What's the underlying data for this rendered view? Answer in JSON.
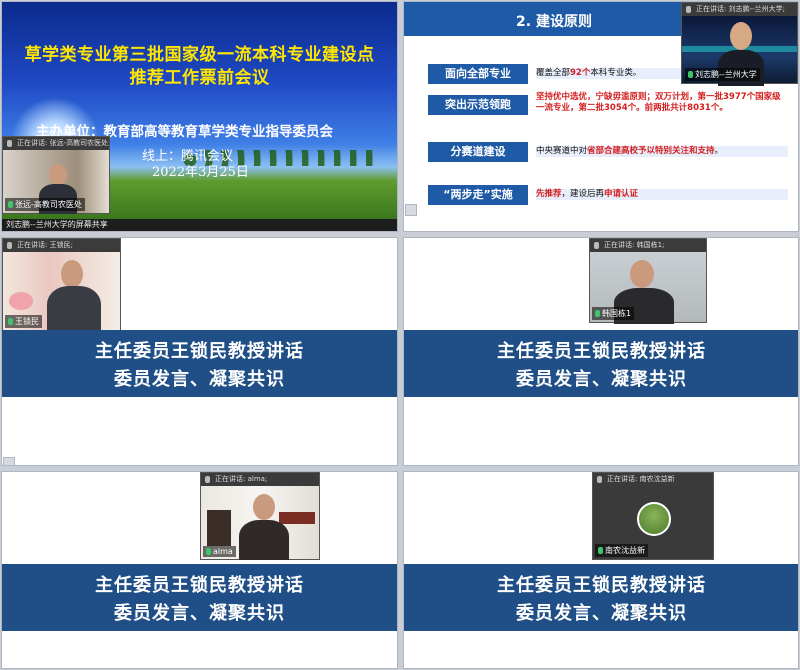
{
  "title_slide": {
    "title_line1": "草学类专业第三批国家级一流本科专业建设点",
    "title_line2": "推荐工作票前会议",
    "organizer": "主办单位：教育部高等教育草学类专业指导委员会",
    "online": "线上：腾讯会议",
    "date": "2022年3月25日",
    "tile_header": "正在讲话: 张远-高教司农医处;",
    "tile_name": "张远-高教司农医处",
    "share_bar": "刘志鹏--兰州大学的屏幕共享"
  },
  "principles_slide": {
    "title": "2. 建设原则",
    "rows": [
      {
        "label": "面向全部专业",
        "text": "覆盖全部92个本科专业类。"
      },
      {
        "label": "突出示范领跑",
        "text": "坚持优中选优，宁缺毋滥原则；双万计划，第一批3977个国家级一流专业，第二批3054个。前两批共计8031个。"
      },
      {
        "label": "分赛道建设",
        "text": "中央赛道中对省部合建高校予以特别关注和支持。"
      },
      {
        "label": "“两步走”实施",
        "text": "先推荐，建设后再申请认证"
      }
    ],
    "tile_header": "正在讲话: 刘志鹏--兰州大学;",
    "tile_name": "刘志鹏--兰州大学"
  },
  "banner": {
    "line1": "主任委员王锁民教授讲话",
    "line2": "委员发言、凝聚共识"
  },
  "speakers": [
    {
      "header": "正在讲话: 王锁民;",
      "name": "王锁民"
    },
    {
      "header": "正在讲话: 韩国栋1;",
      "name": "韩国栋1"
    },
    {
      "header": "正在讲话: alma;",
      "name": "alma"
    },
    {
      "header": "正在讲话: 南农沈益新",
      "name": "南农沈益新"
    }
  ],
  "colors": {
    "accent_blue": "#1f4f86",
    "title_yellow": "#ffe600",
    "emphasis_red": "#d41e1e"
  }
}
